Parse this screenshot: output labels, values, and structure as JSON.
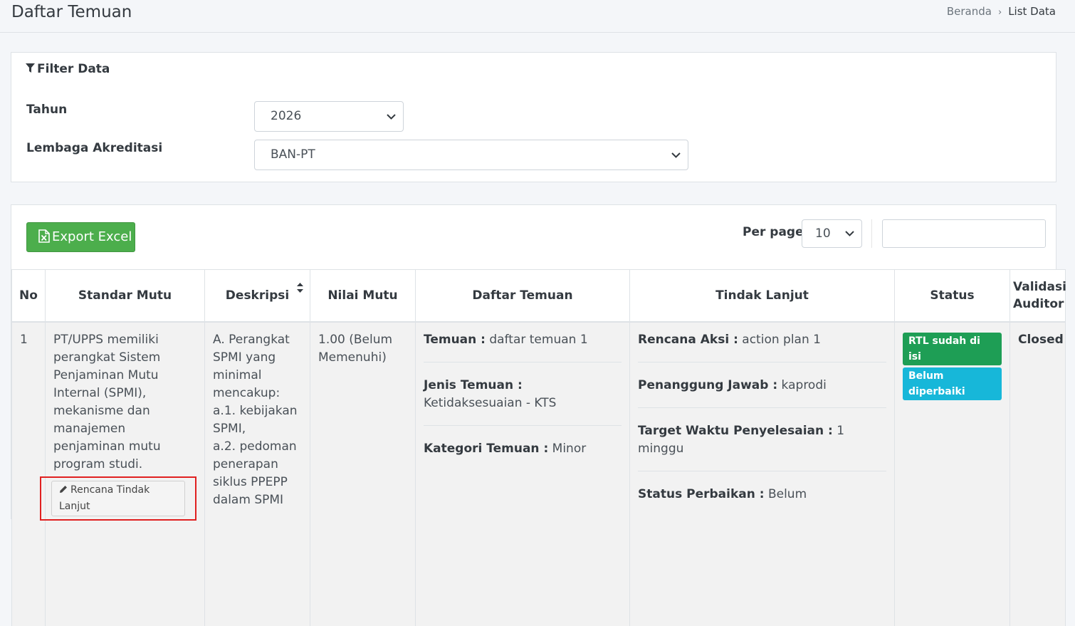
{
  "header": {
    "title": "Daftar Temuan",
    "breadcrumb": [
      "Beranda",
      "List Data"
    ]
  },
  "filter": {
    "title": "Filter Data",
    "tahun_label": "Tahun",
    "tahun_value": "2026",
    "lembaga_label": "Lembaga Akreditasi",
    "lembaga_value": "BAN-PT"
  },
  "toolbar": {
    "export_label": "Export Excel",
    "perpage_label": "Per page:",
    "perpage_value": "10",
    "search_value": ""
  },
  "table": {
    "headers": [
      "No",
      "Standar Mutu",
      "Deskripsi",
      "Nilai Mutu",
      "Daftar Temuan",
      "Tindak Lanjut",
      "Status",
      "Validasi Auditor"
    ],
    "row": {
      "no": "1",
      "standar_mutu": "PT/UPPS memiliki perangkat Sistem Penjaminan Mutu Internal (SPMI), mekanisme dan manajemen penjaminan mutu program studi.",
      "rtl_button": "Rencana Tindak Lanjut",
      "deskripsi": "A. Perangkat SPMI yang minimal mencakup:\na.1. kebijakan SPMI,\na.2. pedoman penerapan siklus PPEPP dalam SPMI",
      "nilai_mutu": "1.00 (Belum Memenuhi)",
      "temuan": [
        {
          "label": "Temuan :",
          "value": " daftar temuan 1"
        },
        {
          "label": "Jenis Temuan :",
          "value": " Ketidaksesuaian - KTS"
        },
        {
          "label": "Kategori Temuan :",
          "value": " Minor"
        }
      ],
      "tindak_lanjut": [
        {
          "label": "Rencana Aksi :",
          "value": " action plan 1"
        },
        {
          "label": "Penanggung Jawab :",
          "value": " kaprodi"
        },
        {
          "label": "Target Waktu Penyelesaian :",
          "value": " 1 minggu"
        },
        {
          "label": "Status Perbaikan :",
          "value": " Belum"
        }
      ],
      "status_badges": [
        "RTL sudah di isi",
        "Belum diperbaiki"
      ],
      "validasi": "Closed"
    }
  },
  "colors": {
    "export_green": "#4cae4c",
    "badge_green": "#1e9e55",
    "badge_cyan": "#17b7d9",
    "highlight_red": "#e02020"
  }
}
